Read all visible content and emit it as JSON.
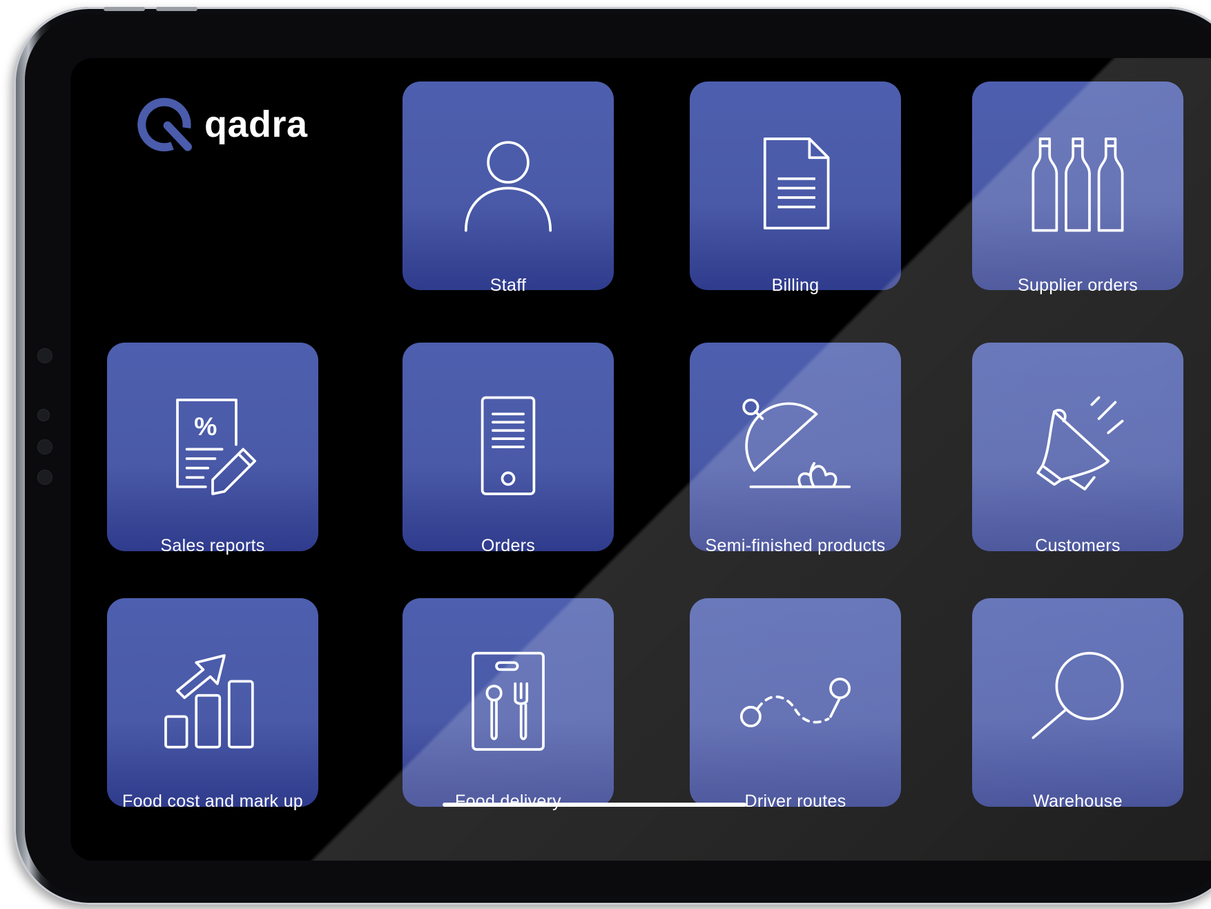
{
  "app": {
    "name": "qadra"
  },
  "colors": {
    "tile": "#4d5fae",
    "tile_dark": "#2f3b8c",
    "logo_mark": "#4a5cab",
    "background": "#000000"
  },
  "tiles": [
    {
      "label": "Staff",
      "icon": "person-icon"
    },
    {
      "label": "Billing",
      "icon": "document-icon"
    },
    {
      "label": "Supplier orders",
      "icon": "bottles-icon"
    },
    {
      "label": "Sales reports",
      "icon": "percent-report-icon"
    },
    {
      "label": "Orders",
      "icon": "mobile-device-icon"
    },
    {
      "label": "Semi-finished products",
      "icon": "cloche-icon"
    },
    {
      "label": "Customers",
      "icon": "megaphone-icon"
    },
    {
      "label": "Food cost and mark up",
      "icon": "growth-chart-icon"
    },
    {
      "label": "Food delivery",
      "icon": "cutlery-box-icon"
    },
    {
      "label": "Driver routes",
      "icon": "route-icon"
    },
    {
      "label": "Warehouse",
      "icon": "magnifier-icon"
    }
  ]
}
